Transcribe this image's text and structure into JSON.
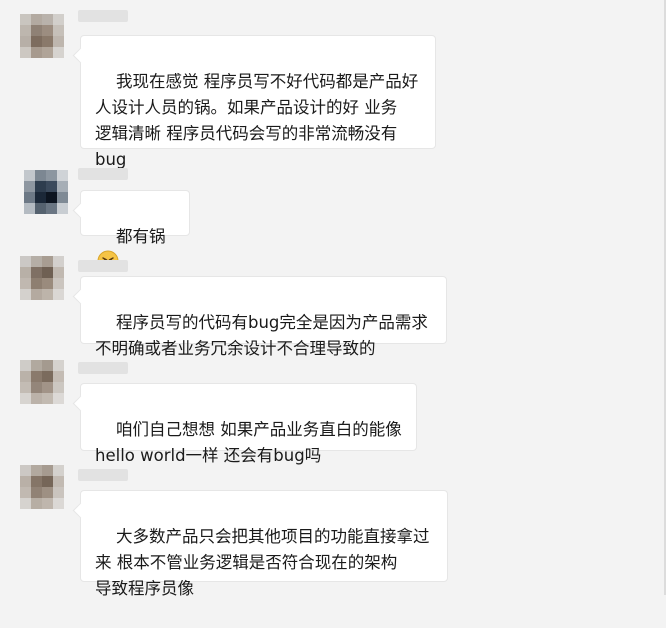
{
  "messages": [
    {
      "text": "我现在感觉 程序员写不好代码都是产品好\n人设计人员的锅。如果产品设计的好 业务\n逻辑清晰 程序员代码会写的非常流畅没有\nbug",
      "has_emoji": false
    },
    {
      "text": "都有锅",
      "has_emoji": true,
      "emoji": "wincing-face-emoji"
    },
    {
      "text": "程序员写的代码有bug完全是因为产品需求\n不明确或者业务冗余设计不合理导致的",
      "has_emoji": false
    },
    {
      "text": "咱们自己想想 如果产品业务直白的能像\nhello world一样 还会有bug吗",
      "has_emoji": false
    },
    {
      "text": "大多数产品只会把其他项目的功能直接拿过\n来 根本不管业务逻辑是否符合现在的架构\n导致程序员像",
      "has_emoji": false
    }
  ]
}
